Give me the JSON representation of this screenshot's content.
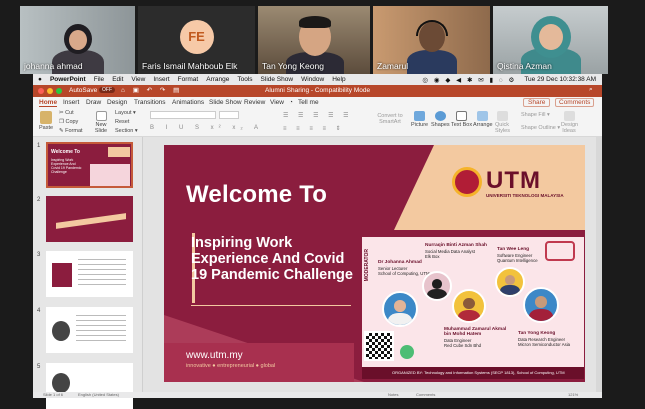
{
  "participants": [
    {
      "name": "johanna ahmad"
    },
    {
      "name": "Faris Ismail Mahboub Elk",
      "initials": "FE"
    },
    {
      "name": "Tan Yong Keong"
    },
    {
      "name": "Zamarul"
    },
    {
      "name": "Qistina Azman"
    }
  ],
  "mac_menu": {
    "app": "PowerPoint",
    "items": [
      "File",
      "Edit",
      "View",
      "Insert",
      "Format",
      "Arrange",
      "Tools",
      "Slide Show",
      "Window",
      "Help"
    ],
    "clock": "Tue 29 Dec 10:32:38 AM"
  },
  "window": {
    "autosave": "AutoSave",
    "autosave_state": "OFF",
    "title": "Alumni Sharing - Compatibility Mode"
  },
  "ribbon": {
    "tabs": [
      "Home",
      "Insert",
      "Draw",
      "Design",
      "Transitions",
      "Animations",
      "Slide Show",
      "Review",
      "View"
    ],
    "tell_me": "Tell me",
    "share": "Share",
    "comments": "Comments",
    "paste": "Paste",
    "cut": "Cut",
    "copy": "Copy",
    "format": "Format",
    "new_slide": "New Slide",
    "layout": "Layout",
    "reset": "Reset",
    "section": "Section",
    "convert_smartart": "Convert to SmartArt",
    "picture": "Picture",
    "shapes": "Shapes",
    "text_box": "Text Box",
    "arrange": "Arrange",
    "quick_styles": "Quick Styles",
    "shape_fill": "Shape Fill",
    "shape_outline": "Shape Outline",
    "design_ideas": "Design Ideas"
  },
  "slide_numbers": [
    "1",
    "2",
    "3",
    "4",
    "5"
  ],
  "slide": {
    "title": "Welcome To",
    "subtitle": "Inspiring Work Experience And Covid 19 Pandemic Challenge",
    "url": "www.utm.my",
    "tagline": "innovative ● entrepreneurial ● global",
    "logo_text": "UTM",
    "logo_sub": "UNIVERSITI TEKNOLOGI MALAYSIA"
  },
  "poster": {
    "moderator_label": "MODERATOR",
    "moderator_name": "Dr Johanna Ahmad",
    "moderator_role": "Senior Lecturer",
    "moderator_org": "School of Computing, UTM",
    "speaker1_name": "Nurraqin Binti Azman Shah",
    "speaker1_role": "Social Media Data Analyst",
    "speaker1_org": "Elk Box",
    "speaker2_name": "Tan Wee Leng",
    "speaker2_role": "Software Engineer",
    "speaker2_org": "Quantum Intelligence",
    "speaker3_name": "Muhammad Zamarul Akmal",
    "speaker3_name2": "bin Mohd Hatem",
    "speaker3_role": "Data Engineer",
    "speaker3_org": "Red Cube Sdn Bhd",
    "speaker4_name": "Tan Yong Keong",
    "speaker4_role": "Data Research Engineer",
    "speaker4_org": "Micron Semiconductor Asia",
    "organized": "ORGANIZED BY:  Technology and Information Systems (SECP 1813), School of Computing, UTM"
  },
  "colors": {
    "maroon": "#8b1d3e",
    "ppt_orange": "#b7472a",
    "peach": "#f3c9a0"
  },
  "status": {
    "slide_of": "Slide 1 of 6",
    "language": "English (United States)",
    "notes": "Notes",
    "comments": "Comments",
    "zoom": "121%"
  }
}
